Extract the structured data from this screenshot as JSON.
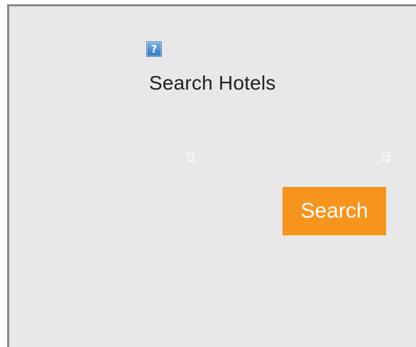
{
  "page": {
    "title": "Search Hotels"
  },
  "help": {
    "glyph": "?",
    "icon_name": "help-icon"
  },
  "actions": {
    "search_label": "Search"
  },
  "icons": {
    "missing_left": "missing-glyph-icon",
    "missing_right": "missing-glyph-icon"
  },
  "colors": {
    "background": "#e8e8e8",
    "frame_border": "#8a8a8a",
    "help_icon": "#2f74c6",
    "button": "#f6941d",
    "button_text": "#ffffff",
    "title_text": "#222222"
  }
}
